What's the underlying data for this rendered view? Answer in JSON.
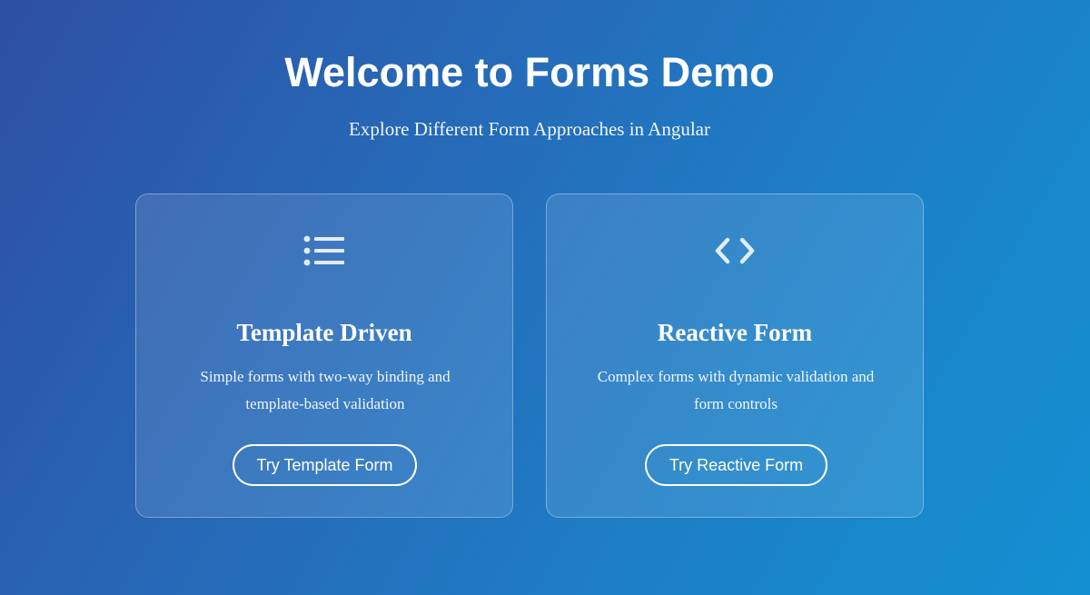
{
  "hero": {
    "title": "Welcome to Forms Demo",
    "subtitle": "Explore Different Form Approaches in Angular"
  },
  "cards": [
    {
      "icon": "list-icon",
      "title": "Template Driven",
      "description": "Simple forms with two-way binding and template-based validation",
      "button_label": "Try Template Form"
    },
    {
      "icon": "code-icon",
      "title": "Reactive Form",
      "description": "Complex forms with dynamic validation and form controls",
      "button_label": "Try Reactive Form"
    }
  ],
  "colors": {
    "background_start": "#2e4fa3",
    "background_end": "#1490d2",
    "text": "#ffffff"
  }
}
